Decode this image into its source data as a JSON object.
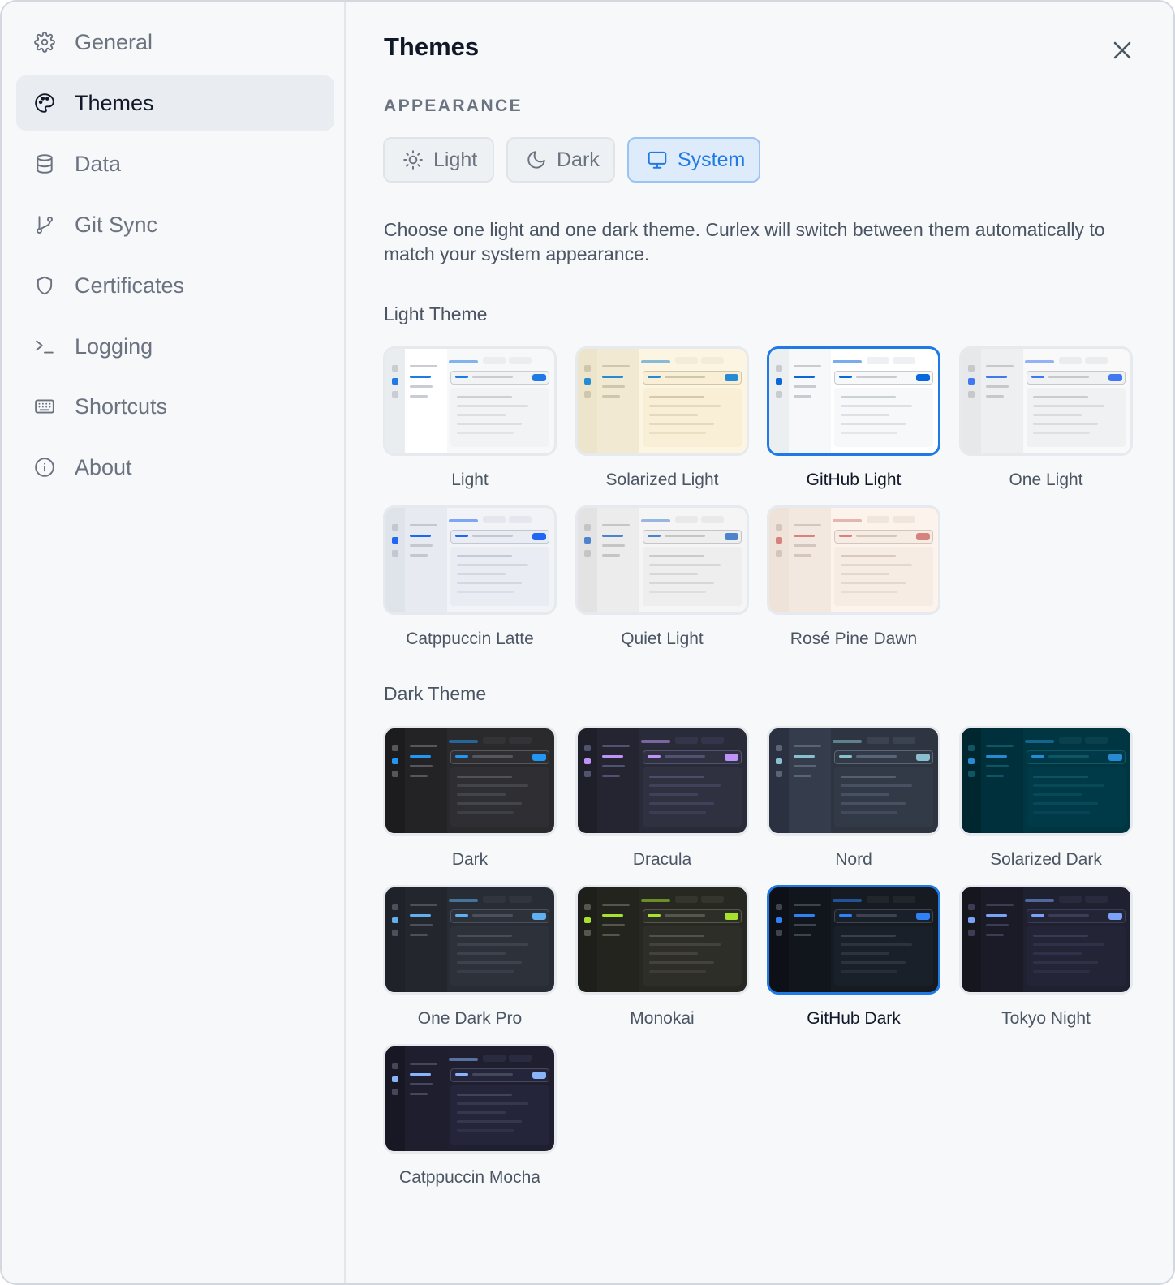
{
  "sidebar": {
    "items": [
      {
        "label": "General",
        "icon": "gear-icon",
        "active": false
      },
      {
        "label": "Themes",
        "icon": "palette-icon",
        "active": true
      },
      {
        "label": "Data",
        "icon": "database-icon",
        "active": false
      },
      {
        "label": "Git Sync",
        "icon": "git-branch-icon",
        "active": false
      },
      {
        "label": "Certificates",
        "icon": "shield-icon",
        "active": false
      },
      {
        "label": "Logging",
        "icon": "terminal-icon",
        "active": false
      },
      {
        "label": "Shortcuts",
        "icon": "keyboard-icon",
        "active": false
      },
      {
        "label": "About",
        "icon": "info-icon",
        "active": false
      }
    ]
  },
  "header": {
    "title": "Themes",
    "close_icon": "close-icon"
  },
  "appearance": {
    "label": "APPEARANCE",
    "options": [
      {
        "label": "Light",
        "icon": "sun-icon"
      },
      {
        "label": "Dark",
        "icon": "moon-icon"
      },
      {
        "label": "System",
        "icon": "monitor-icon"
      }
    ],
    "selected": "System",
    "description": "Choose one light and one dark theme. Curlex will switch between them automatically to match your system appearance."
  },
  "light_theme": {
    "heading": "Light Theme",
    "selected": "GitHub Light",
    "themes": [
      {
        "name": "Light",
        "colors": {
          "side": "#eaedf0",
          "list": "#ffffff",
          "main": "#f7f8fa",
          "pane": "#f1f3f5",
          "line": "#c9cdd2",
          "accent": "#1f7ae6",
          "tab": "#ecedf0"
        }
      },
      {
        "name": "Solarized Light",
        "colors": {
          "side": "#ede5cb",
          "list": "#f1e9d2",
          "main": "#fcf5e1",
          "pane": "#f8efd6",
          "line": "#cfc7ad",
          "accent": "#268bd2",
          "tab": "#f3ecd6"
        }
      },
      {
        "name": "GitHub Light",
        "colors": {
          "side": "#eceff2",
          "list": "#f6f8fa",
          "main": "#ffffff",
          "pane": "#f6f8fa",
          "line": "#c8ccd1",
          "accent": "#0969da",
          "tab": "#eef0f3"
        }
      },
      {
        "name": "One Light",
        "colors": {
          "side": "#e7e8ea",
          "list": "#eeeff1",
          "main": "#f9f9fa",
          "pane": "#f0f1f2",
          "line": "#c6c8cc",
          "accent": "#4078f2",
          "tab": "#ebecee"
        }
      },
      {
        "name": "Catppuccin Latte",
        "colors": {
          "side": "#dfe3ea",
          "list": "#e7eaf1",
          "main": "#f1f3f7",
          "pane": "#e9ecf3",
          "line": "#c2c7d2",
          "accent": "#1e66f5",
          "tab": "#e4e7ee"
        }
      },
      {
        "name": "Quiet Light",
        "colors": {
          "side": "#e3e3e3",
          "list": "#ececec",
          "main": "#f5f5f5",
          "pane": "#eeeeee",
          "line": "#c5c5c5",
          "accent": "#4b83cd",
          "tab": "#e9e9e9"
        }
      },
      {
        "name": "Rosé Pine Dawn",
        "colors": {
          "side": "#efe2d8",
          "list": "#f3e8df",
          "main": "#fbf3ec",
          "pane": "#f7ece3",
          "line": "#d5c6bd",
          "accent": "#d7827e",
          "tab": "#f1e6de"
        }
      }
    ]
  },
  "dark_theme": {
    "heading": "Dark Theme",
    "selected": "GitHub Dark",
    "themes": [
      {
        "name": "Dark",
        "colors": {
          "side": "#1c1c1e",
          "list": "#232325",
          "main": "#2a2a2d",
          "pane": "#2f2f33",
          "line": "#55575c",
          "accent": "#2196f3",
          "tab": "#333337"
        }
      },
      {
        "name": "Dracula",
        "colors": {
          "side": "#1e1f29",
          "list": "#242530",
          "main": "#2a2b38",
          "pane": "#2f3040",
          "line": "#4f5270",
          "accent": "#bd93f9",
          "tab": "#34354a"
        }
      },
      {
        "name": "Nord",
        "colors": {
          "side": "#2b3140",
          "list": "#353c4c",
          "main": "#2e3440",
          "pane": "#323a48",
          "line": "#5a6477",
          "accent": "#88c0d0",
          "tab": "#3b4252"
        }
      },
      {
        "name": "Solarized Dark",
        "colors": {
          "side": "#002630",
          "list": "#00303b",
          "main": "#003542",
          "pane": "#003a48",
          "line": "#0f5563",
          "accent": "#268bd2",
          "tab": "#0a3f4c"
        }
      },
      {
        "name": "One Dark Pro",
        "colors": {
          "side": "#1f2228",
          "list": "#23262d",
          "main": "#282c34",
          "pane": "#2d3139",
          "line": "#4b515c",
          "accent": "#61afef",
          "tab": "#31353e"
        }
      },
      {
        "name": "Monokai",
        "colors": {
          "side": "#1e1f1a",
          "list": "#23241e",
          "main": "#272822",
          "pane": "#2d2e27",
          "line": "#55564c",
          "accent": "#a6e22e",
          "tab": "#34352d"
        }
      },
      {
        "name": "GitHub Dark",
        "colors": {
          "side": "#0d1117",
          "list": "#11161d",
          "main": "#161b22",
          "pane": "#1a2029",
          "line": "#3d444d",
          "accent": "#2f81f7",
          "tab": "#21262d"
        }
      },
      {
        "name": "Tokyo Night",
        "colors": {
          "side": "#16161e",
          "list": "#1a1b26",
          "main": "#1f2030",
          "pane": "#232436",
          "line": "#3b3d57",
          "accent": "#7aa2f7",
          "tab": "#292a3d"
        }
      },
      {
        "name": "Catppuccin Mocha",
        "colors": {
          "side": "#181825",
          "list": "#1e1e2e",
          "main": "#1f1f30",
          "pane": "#24243a",
          "line": "#45475a",
          "accent": "#89b4fa",
          "tab": "#2a2b40"
        }
      }
    ]
  }
}
